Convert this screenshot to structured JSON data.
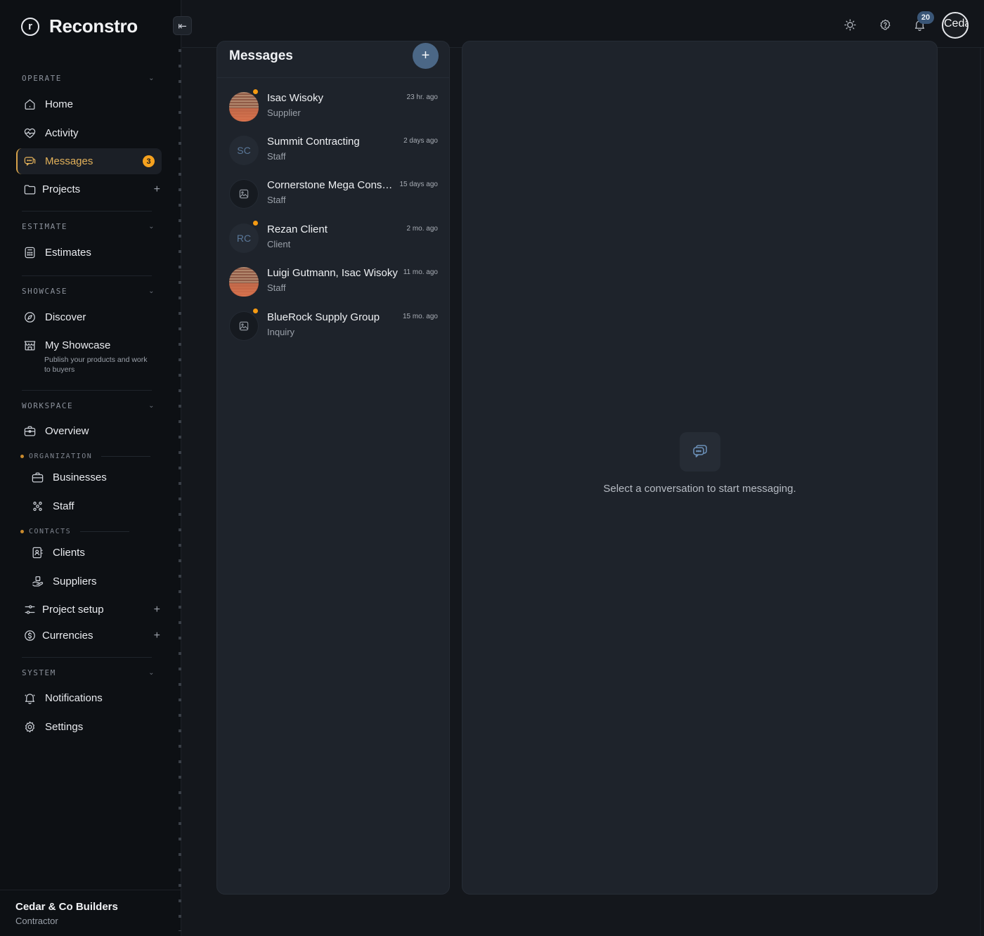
{
  "brand": {
    "logo_letter": "r",
    "name": "Reconstro"
  },
  "sidebar": {
    "collapse_icon": "⇤",
    "sections": {
      "operate": "OPERATE",
      "estimate": "ESTIMATE",
      "showcase": "SHOWCASE",
      "workspace": "WORKSPACE",
      "system": "SYSTEM"
    },
    "items": {
      "home": "Home",
      "activity": "Activity",
      "messages": "Messages",
      "messages_badge": "3",
      "projects": "Projects",
      "estimates": "Estimates",
      "discover": "Discover",
      "my_showcase": "My Showcase",
      "my_showcase_sub": "Publish your products and work to buyers",
      "overview": "Overview",
      "businesses": "Businesses",
      "staff": "Staff",
      "clients": "Clients",
      "suppliers": "Suppliers",
      "project_setup": "Project setup",
      "currencies": "Currencies",
      "notifications": "Notifications",
      "settings": "Settings"
    },
    "groups": {
      "organization": "ORGANIZATION",
      "contacts": "CONTACTS"
    },
    "plus": "+",
    "chevron": "⌄",
    "footer": {
      "org_name": "Cedar & Co Builders",
      "org_role": "Contractor"
    }
  },
  "topbar": {
    "notification_count": "20",
    "avatar_text": "Ceda",
    "icons": [
      "sun-icon",
      "help-icon",
      "bell-icon"
    ]
  },
  "messages": {
    "title": "Messages",
    "new_button": "+",
    "conversations": [
      {
        "name": "Isac Wisoky",
        "role": "Supplier",
        "time": "23 hr. ago",
        "avatar": "photo",
        "online": true
      },
      {
        "name": "Summit Contracting",
        "role": "Staff",
        "time": "2 days ago",
        "avatar": "SC",
        "online": false
      },
      {
        "name": "Cornerstone Mega Construction",
        "role": "Staff",
        "time": "15 days ago",
        "avatar": "image",
        "online": false
      },
      {
        "name": "Rezan Client",
        "role": "Client",
        "time": "2 mo. ago",
        "avatar": "RC",
        "online": true
      },
      {
        "name": "Luigi Gutmann, Isac Wisoky",
        "role": "Staff",
        "time": "11 mo. ago",
        "avatar": "photo",
        "online": false
      },
      {
        "name": "BlueRock Supply Group",
        "role": "Inquiry",
        "time": "15 mo. ago",
        "avatar": "image",
        "online": true
      }
    ]
  },
  "chat": {
    "empty_text": "Select a conversation to start messaging."
  },
  "colors": {
    "accent": "#e2b15a",
    "badge": "#f5a11e",
    "primary_button": "#4b6786",
    "online_dot": "#f59a12"
  }
}
